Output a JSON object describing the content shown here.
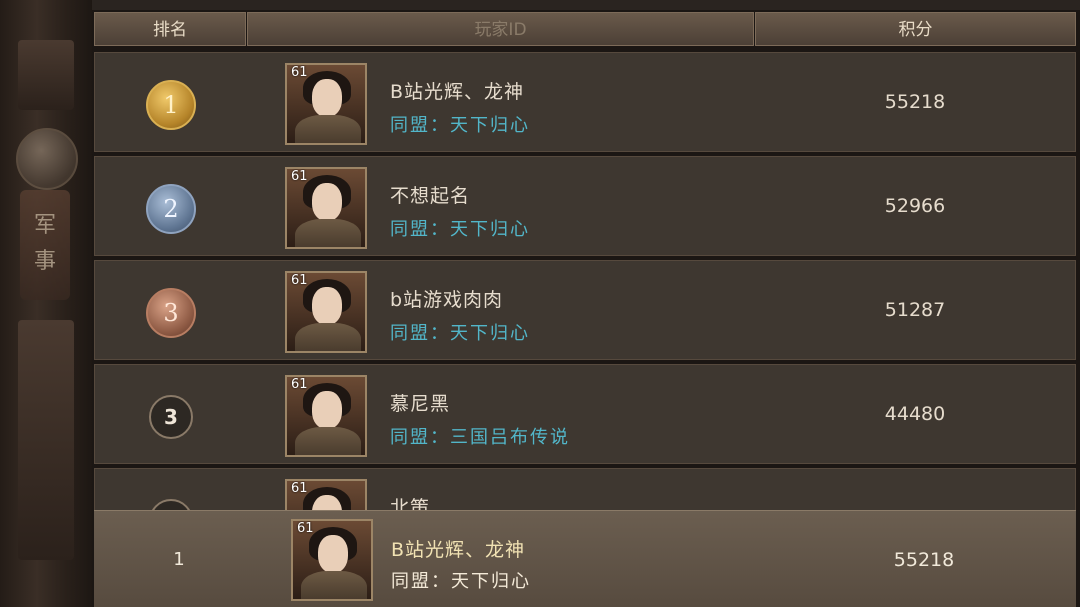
{
  "header": {
    "rank_label": "排名",
    "player_label": "玩家ID",
    "score_label": "积分"
  },
  "side": {
    "tab_label": "军\n事"
  },
  "rows": [
    {
      "rank": "1",
      "badge": "gold",
      "level": "61",
      "name": "B站光辉、龙神",
      "alliance": "同盟：天下归心",
      "score": "55218"
    },
    {
      "rank": "2",
      "badge": "silver",
      "level": "61",
      "name": "不想起名",
      "alliance": "同盟：天下归心",
      "score": "52966"
    },
    {
      "rank": "3",
      "badge": "bronze",
      "level": "61",
      "name": "b站游戏肉肉",
      "alliance": "同盟：天下归心",
      "score": "51287"
    },
    {
      "rank": "3",
      "badge": "plain",
      "level": "61",
      "name": "慕尼黑",
      "alliance": "同盟：三国吕布传说",
      "score": "44480"
    },
    {
      "rank": "",
      "badge": "plain",
      "level": "61",
      "name": "北策",
      "alliance": "",
      "score": ""
    }
  ],
  "mine": {
    "rank": "1",
    "level": "61",
    "name": "B站光辉、龙神",
    "alliance": "同盟：天下归心",
    "score": "55218"
  },
  "colors": {
    "gold": "#d9b053",
    "silver": "#8fa3bf",
    "bronze": "#b77d62",
    "alliance": "#52b6c9",
    "row_bg": "#3e3730"
  }
}
